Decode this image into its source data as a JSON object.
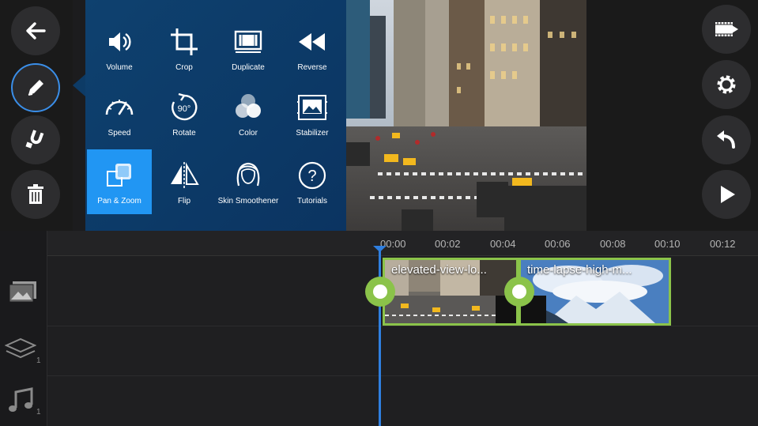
{
  "left_toolbar": [
    {
      "icon": "back-arrow-icon"
    },
    {
      "icon": "pencil-icon",
      "active": true
    },
    {
      "icon": "magnet-icon"
    },
    {
      "icon": "trash-icon"
    }
  ],
  "edit_menu": {
    "items": [
      {
        "label": "Volume",
        "icon": "volume-icon"
      },
      {
        "label": "Crop",
        "icon": "crop-icon"
      },
      {
        "label": "Duplicate",
        "icon": "duplicate-icon"
      },
      {
        "label": "Reverse",
        "icon": "reverse-icon"
      },
      {
        "label": "Speed",
        "icon": "speed-icon"
      },
      {
        "label": "Rotate",
        "icon": "rotate-icon"
      },
      {
        "label": "Color",
        "icon": "color-icon"
      },
      {
        "label": "Stabilizer",
        "icon": "stabilizer-icon"
      },
      {
        "label": "Pan & Zoom",
        "icon": "pan-zoom-icon",
        "selected": true
      },
      {
        "label": "Flip",
        "icon": "flip-icon"
      },
      {
        "label": "Skin Smoothener",
        "icon": "skin-smoothener-icon"
      },
      {
        "label": "Tutorials",
        "icon": "tutorials-icon"
      }
    ],
    "rotate_badge": "90°"
  },
  "right_toolbar": [
    {
      "icon": "export-film-icon"
    },
    {
      "icon": "settings-gear-icon"
    },
    {
      "icon": "undo-icon"
    },
    {
      "icon": "play-icon"
    }
  ],
  "timeline": {
    "ruler_ticks": [
      "00:00",
      "00:02",
      "00:04",
      "00:06",
      "00:08",
      "00:10",
      "00:12"
    ],
    "tracks": [
      {
        "icon": "video-track-icon",
        "count": ""
      },
      {
        "icon": "layers-track-icon",
        "count": "1"
      },
      {
        "icon": "music-track-icon",
        "count": "1"
      }
    ],
    "clips": [
      {
        "title": "elevated-view-lo..."
      },
      {
        "title": "time-lapse-high-m..."
      }
    ]
  },
  "colors": {
    "menu_bg": "#0d3b66",
    "menu_selected": "#2196f3",
    "clip_border": "#8bc34a",
    "playhead": "#2f7fe0"
  }
}
